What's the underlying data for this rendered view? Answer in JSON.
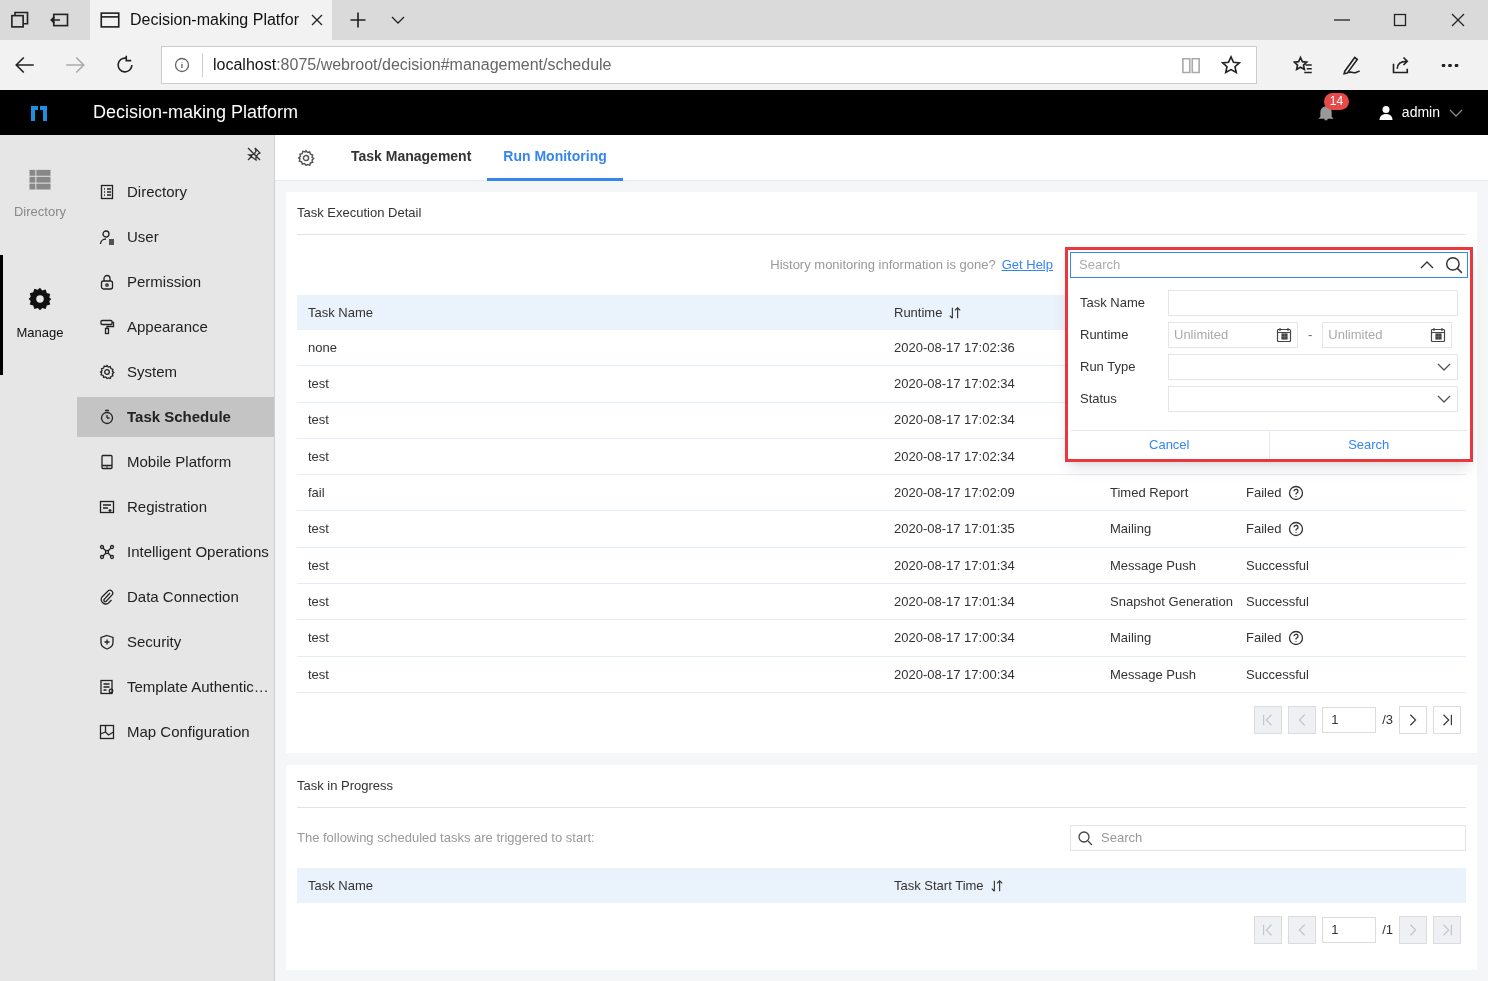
{
  "browser": {
    "tab_title": "Decision-making Platfor",
    "url_host": "localhost",
    "url_path": ":8075/webroot/decision#management/schedule"
  },
  "header": {
    "title": "Decision-making Platform",
    "notifications": "14",
    "user": "admin"
  },
  "rail": [
    {
      "label": "Directory",
      "selected": false
    },
    {
      "label": "Manage",
      "selected": true
    }
  ],
  "sidebar": {
    "items": [
      {
        "label": "Directory",
        "selected": false
      },
      {
        "label": "User",
        "selected": false
      },
      {
        "label": "Permission",
        "selected": false
      },
      {
        "label": "Appearance",
        "selected": false
      },
      {
        "label": "System",
        "selected": false
      },
      {
        "label": "Task Schedule",
        "selected": true
      },
      {
        "label": "Mobile Platform",
        "selected": false
      },
      {
        "label": "Registration",
        "selected": false
      },
      {
        "label": "Intelligent Operations",
        "selected": false
      },
      {
        "label": "Data Connection",
        "selected": false
      },
      {
        "label": "Security",
        "selected": false
      },
      {
        "label": "Template Authentic…",
        "selected": false
      },
      {
        "label": "Map Configuration",
        "selected": false
      }
    ]
  },
  "tabs": [
    {
      "label": "Task Management",
      "selected": false
    },
    {
      "label": "Run Monitoring",
      "selected": true
    }
  ],
  "execution": {
    "title": "Task Execution Detail",
    "help_text": "History monitoring information is gone?",
    "help_link": "Get Help",
    "columns": [
      "Task Name",
      "Runtime"
    ],
    "rows": [
      {
        "name": "none",
        "runtime": "2020-08-17 17:02:36"
      },
      {
        "name": "test",
        "runtime": "2020-08-17 17:02:34"
      },
      {
        "name": "test",
        "runtime": "2020-08-17 17:02:34"
      },
      {
        "name": "test",
        "runtime": "2020-08-17 17:02:34"
      },
      {
        "name": "fail",
        "runtime": "2020-08-17 17:02:09",
        "type": "Timed Report",
        "status": "Failed",
        "help": true
      },
      {
        "name": "test",
        "runtime": "2020-08-17 17:01:35",
        "type": "Mailing",
        "status": "Failed",
        "help": true
      },
      {
        "name": "test",
        "runtime": "2020-08-17 17:01:34",
        "type": "Message Push",
        "status": "Successful",
        "help": false
      },
      {
        "name": "test",
        "runtime": "2020-08-17 17:01:34",
        "type": "Snapshot Generation",
        "status": "Successful",
        "help": false
      },
      {
        "name": "test",
        "runtime": "2020-08-17 17:00:34",
        "type": "Mailing",
        "status": "Failed",
        "help": true
      },
      {
        "name": "test",
        "runtime": "2020-08-17 17:00:34",
        "type": "Message Push",
        "status": "Successful",
        "help": false
      }
    ],
    "pager": {
      "page": "1",
      "total": "/3",
      "first_disabled": true,
      "prev_disabled": true,
      "next_disabled": false,
      "last_disabled": false
    }
  },
  "filter": {
    "search_placeholder": "Search",
    "fields": [
      {
        "label": "Task Name",
        "kind": "text"
      },
      {
        "label": "Runtime",
        "kind": "range",
        "placeholder_from": "Unlimited",
        "separator": "-",
        "placeholder_to": "Unlimited"
      },
      {
        "label": "Run Type",
        "kind": "select"
      },
      {
        "label": "Status",
        "kind": "select"
      }
    ],
    "buttons": [
      "Cancel",
      "Search"
    ]
  },
  "progress": {
    "title": "Task in Progress",
    "note": "The following scheduled tasks are triggered to start:",
    "search_placeholder": "Search",
    "columns": [
      "Task Name",
      "Task Start Time"
    ],
    "pager": {
      "page": "1",
      "total": "/1",
      "first_disabled": true,
      "prev_disabled": true,
      "next_disabled": true,
      "last_disabled": true
    }
  }
}
